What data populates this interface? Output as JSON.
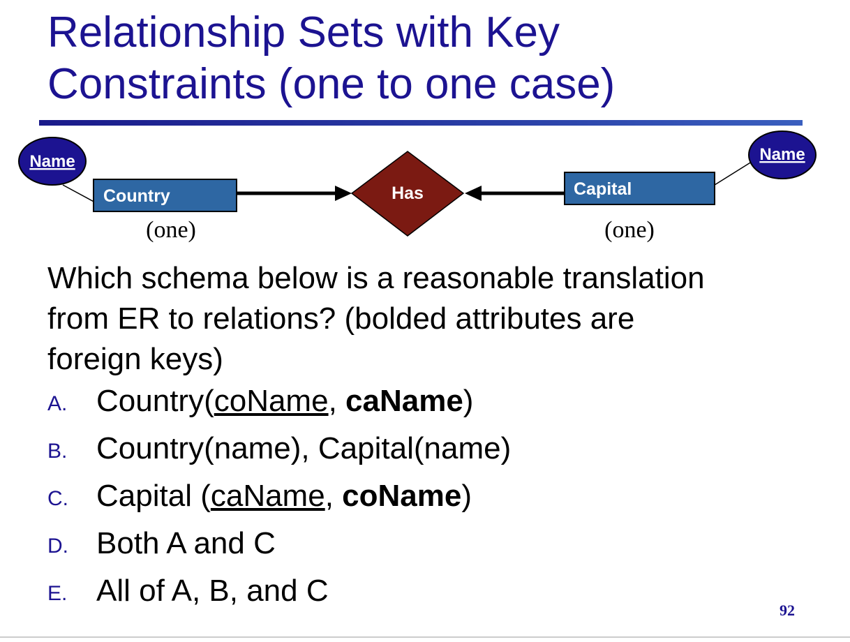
{
  "slide": {
    "title_line1": "Relationship Sets with Key",
    "title_line2": "Constraints (one to one case)",
    "page_number": "92"
  },
  "diagram": {
    "left_attribute": "Name",
    "left_entity": "Country",
    "relationship": "Has",
    "right_entity": "Capital",
    "right_attribute": "Name",
    "left_cardinality": "(one)",
    "right_cardinality": "(one)",
    "colors": {
      "entity_fill": "#2e67a3",
      "attribute_fill": "#1c1391",
      "relationship_fill": "#7b1a12"
    }
  },
  "question": {
    "line1": "Which schema below is a reasonable translation",
    "line2": "from ER to relations? (bolded attributes are",
    "line3": "foreign keys)"
  },
  "options": {
    "a": {
      "letter": "A.",
      "pre": "Country(",
      "underlined": "coName",
      "mid": ", ",
      "bold": "caName",
      "post": ")"
    },
    "b": {
      "letter": "B.",
      "text": "Country(name), Capital(name)"
    },
    "c": {
      "letter": "C.",
      "pre": "Capital (",
      "underlined": "caName",
      "mid": ", ",
      "bold": "coName",
      "post": ")"
    },
    "d": {
      "letter": "D.",
      "text": "Both A and C"
    },
    "e": {
      "letter": "E.",
      "text": "All of A, B, and C"
    }
  }
}
